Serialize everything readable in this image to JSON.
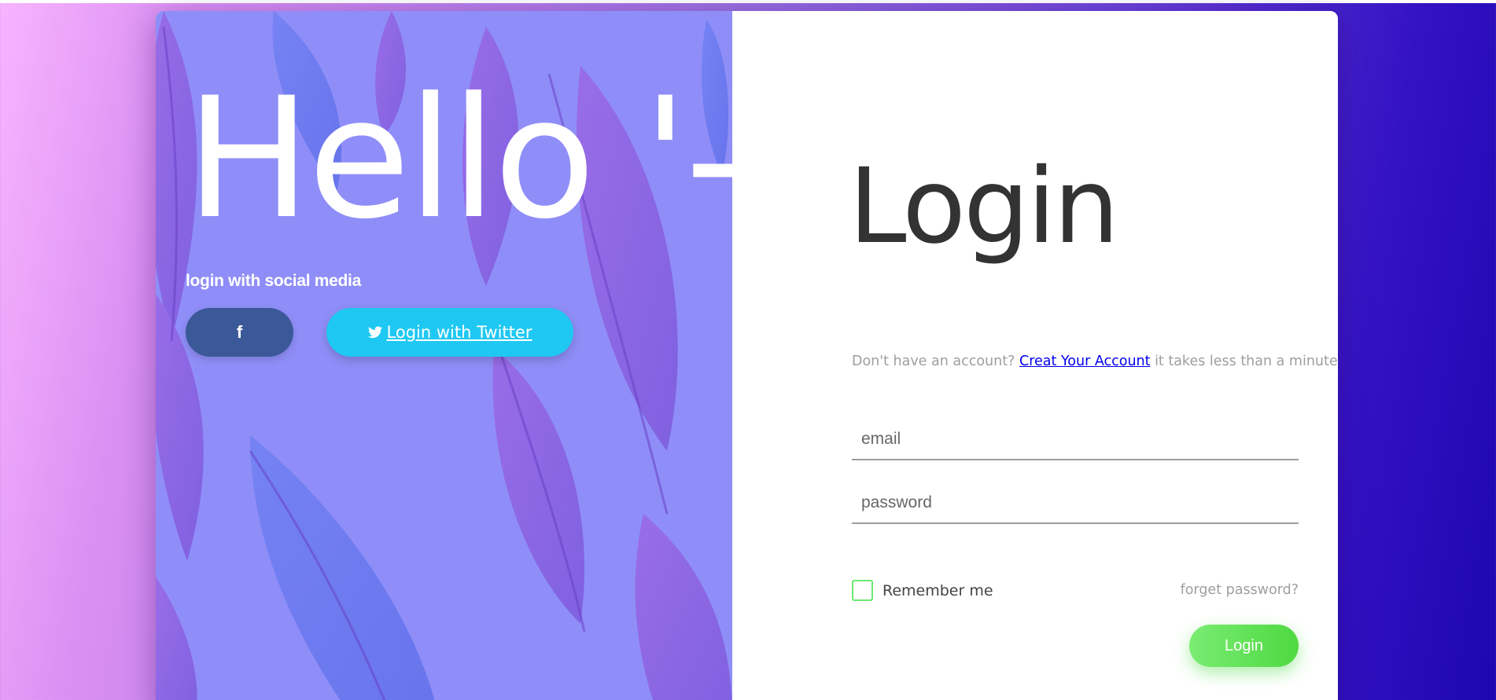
{
  "hero": {
    "greeting": "Hello '-'",
    "social_caption": "login with social media",
    "facebook": {
      "icon": "facebook-icon",
      "label": "f",
      "color": "#3b5998"
    },
    "twitter": {
      "icon": "twitter-icon",
      "label": " Login with Twitter",
      "color": "#1fc8f2"
    },
    "panel_color": "#8f8ef8"
  },
  "form": {
    "title": "Login",
    "signup_prefix": "Don't have an account? ",
    "signup_link": "Creat Your Account",
    "signup_suffix": " it takes less than a minute",
    "email_placeholder": "email",
    "password_placeholder": "password",
    "remember_label": "Remember me",
    "remember_checked": false,
    "forgot_label": "forget password?",
    "submit_label": "Login",
    "accent_color": "#5ddf52"
  }
}
